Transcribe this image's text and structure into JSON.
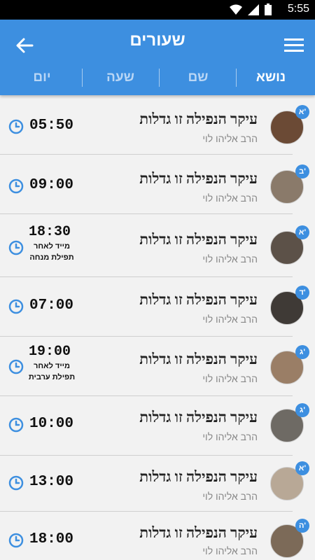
{
  "status_bar": {
    "time": "5:55"
  },
  "header": {
    "title": "שעורים"
  },
  "tabs": [
    {
      "label": "נושא",
      "active": true
    },
    {
      "label": "שם",
      "active": false
    },
    {
      "label": "שעה",
      "active": false
    },
    {
      "label": "יום",
      "active": false
    }
  ],
  "lessons": [
    {
      "title": "עיקר הנפילה זו גדלות",
      "rabbi": "הרב אליהו לוי",
      "day": "א'",
      "time": "05:50",
      "note": ""
    },
    {
      "title": "עיקר הנפילה זו גדלות",
      "rabbi": "הרב אליהו לוי",
      "day": "ב'",
      "time": "09:00",
      "note": ""
    },
    {
      "title": "עיקר הנפילה זו גדלות",
      "rabbi": "הרב אליהו לוי",
      "day": "א'",
      "time": "18:30",
      "note": "מייד לאחר תפילת מנחה"
    },
    {
      "title": "עיקר הנפילה זו גדלות",
      "rabbi": "הרב אליהו לוי",
      "day": "ד'",
      "time": "07:00",
      "note": ""
    },
    {
      "title": "עיקר הנפילה זו גדלות",
      "rabbi": "הרב אליהו לוי",
      "day": "ג'",
      "time": "19:00",
      "note": "מייד לאחר תפילת ערבית"
    },
    {
      "title": "עיקר הנפילה זו גדלות",
      "rabbi": "הרב אליהו לוי",
      "day": "ג'",
      "time": "10:00",
      "note": ""
    },
    {
      "title": "עיקר הנפילה זו גדלות",
      "rabbi": "הרב אליהו לוי",
      "day": "א'",
      "time": "13:00",
      "note": ""
    },
    {
      "title": "עיקר הנפילה זו גדלות",
      "rabbi": "הרב אליהו לוי",
      "day": "ה'",
      "time": "18:00",
      "note": ""
    }
  ],
  "colors": {
    "accent": "#3d8fe0",
    "tab_inactive": "#b9d6f5",
    "background": "#f2f2f2"
  }
}
